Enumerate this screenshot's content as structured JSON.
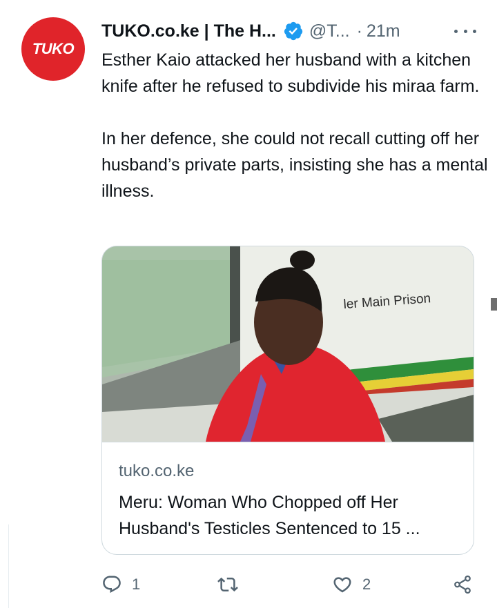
{
  "tweet": {
    "avatar_text": "TUKO",
    "author_name": "TUKO.co.ke | The H...",
    "handle": "@T...",
    "separator": "·",
    "time": "21m",
    "paragraphs": [
      "Esther Kaio attacked her husband with a kitchen knife after he refused to subdivide his miraa farm.",
      "In her defence, she could not recall cutting off her husband’s private parts, insisting she has a mental illness."
    ]
  },
  "card": {
    "sign_text": "ler  Main Prison",
    "domain": "tuko.co.ke",
    "title_line1": "Meru: Woman Who Chopped off Her",
    "title_line2": "Husband's Testicles Sentenced to 15 ..."
  },
  "actions": {
    "reply_count": "1",
    "like_count": "2"
  },
  "colors": {
    "brand_red": "#e0242a",
    "verified_blue": "#1d9bf0",
    "secondary_text": "#536471"
  },
  "icons": [
    "verified-badge-icon",
    "more-options-icon",
    "reply-icon",
    "retweet-icon",
    "like-icon",
    "share-icon"
  ]
}
